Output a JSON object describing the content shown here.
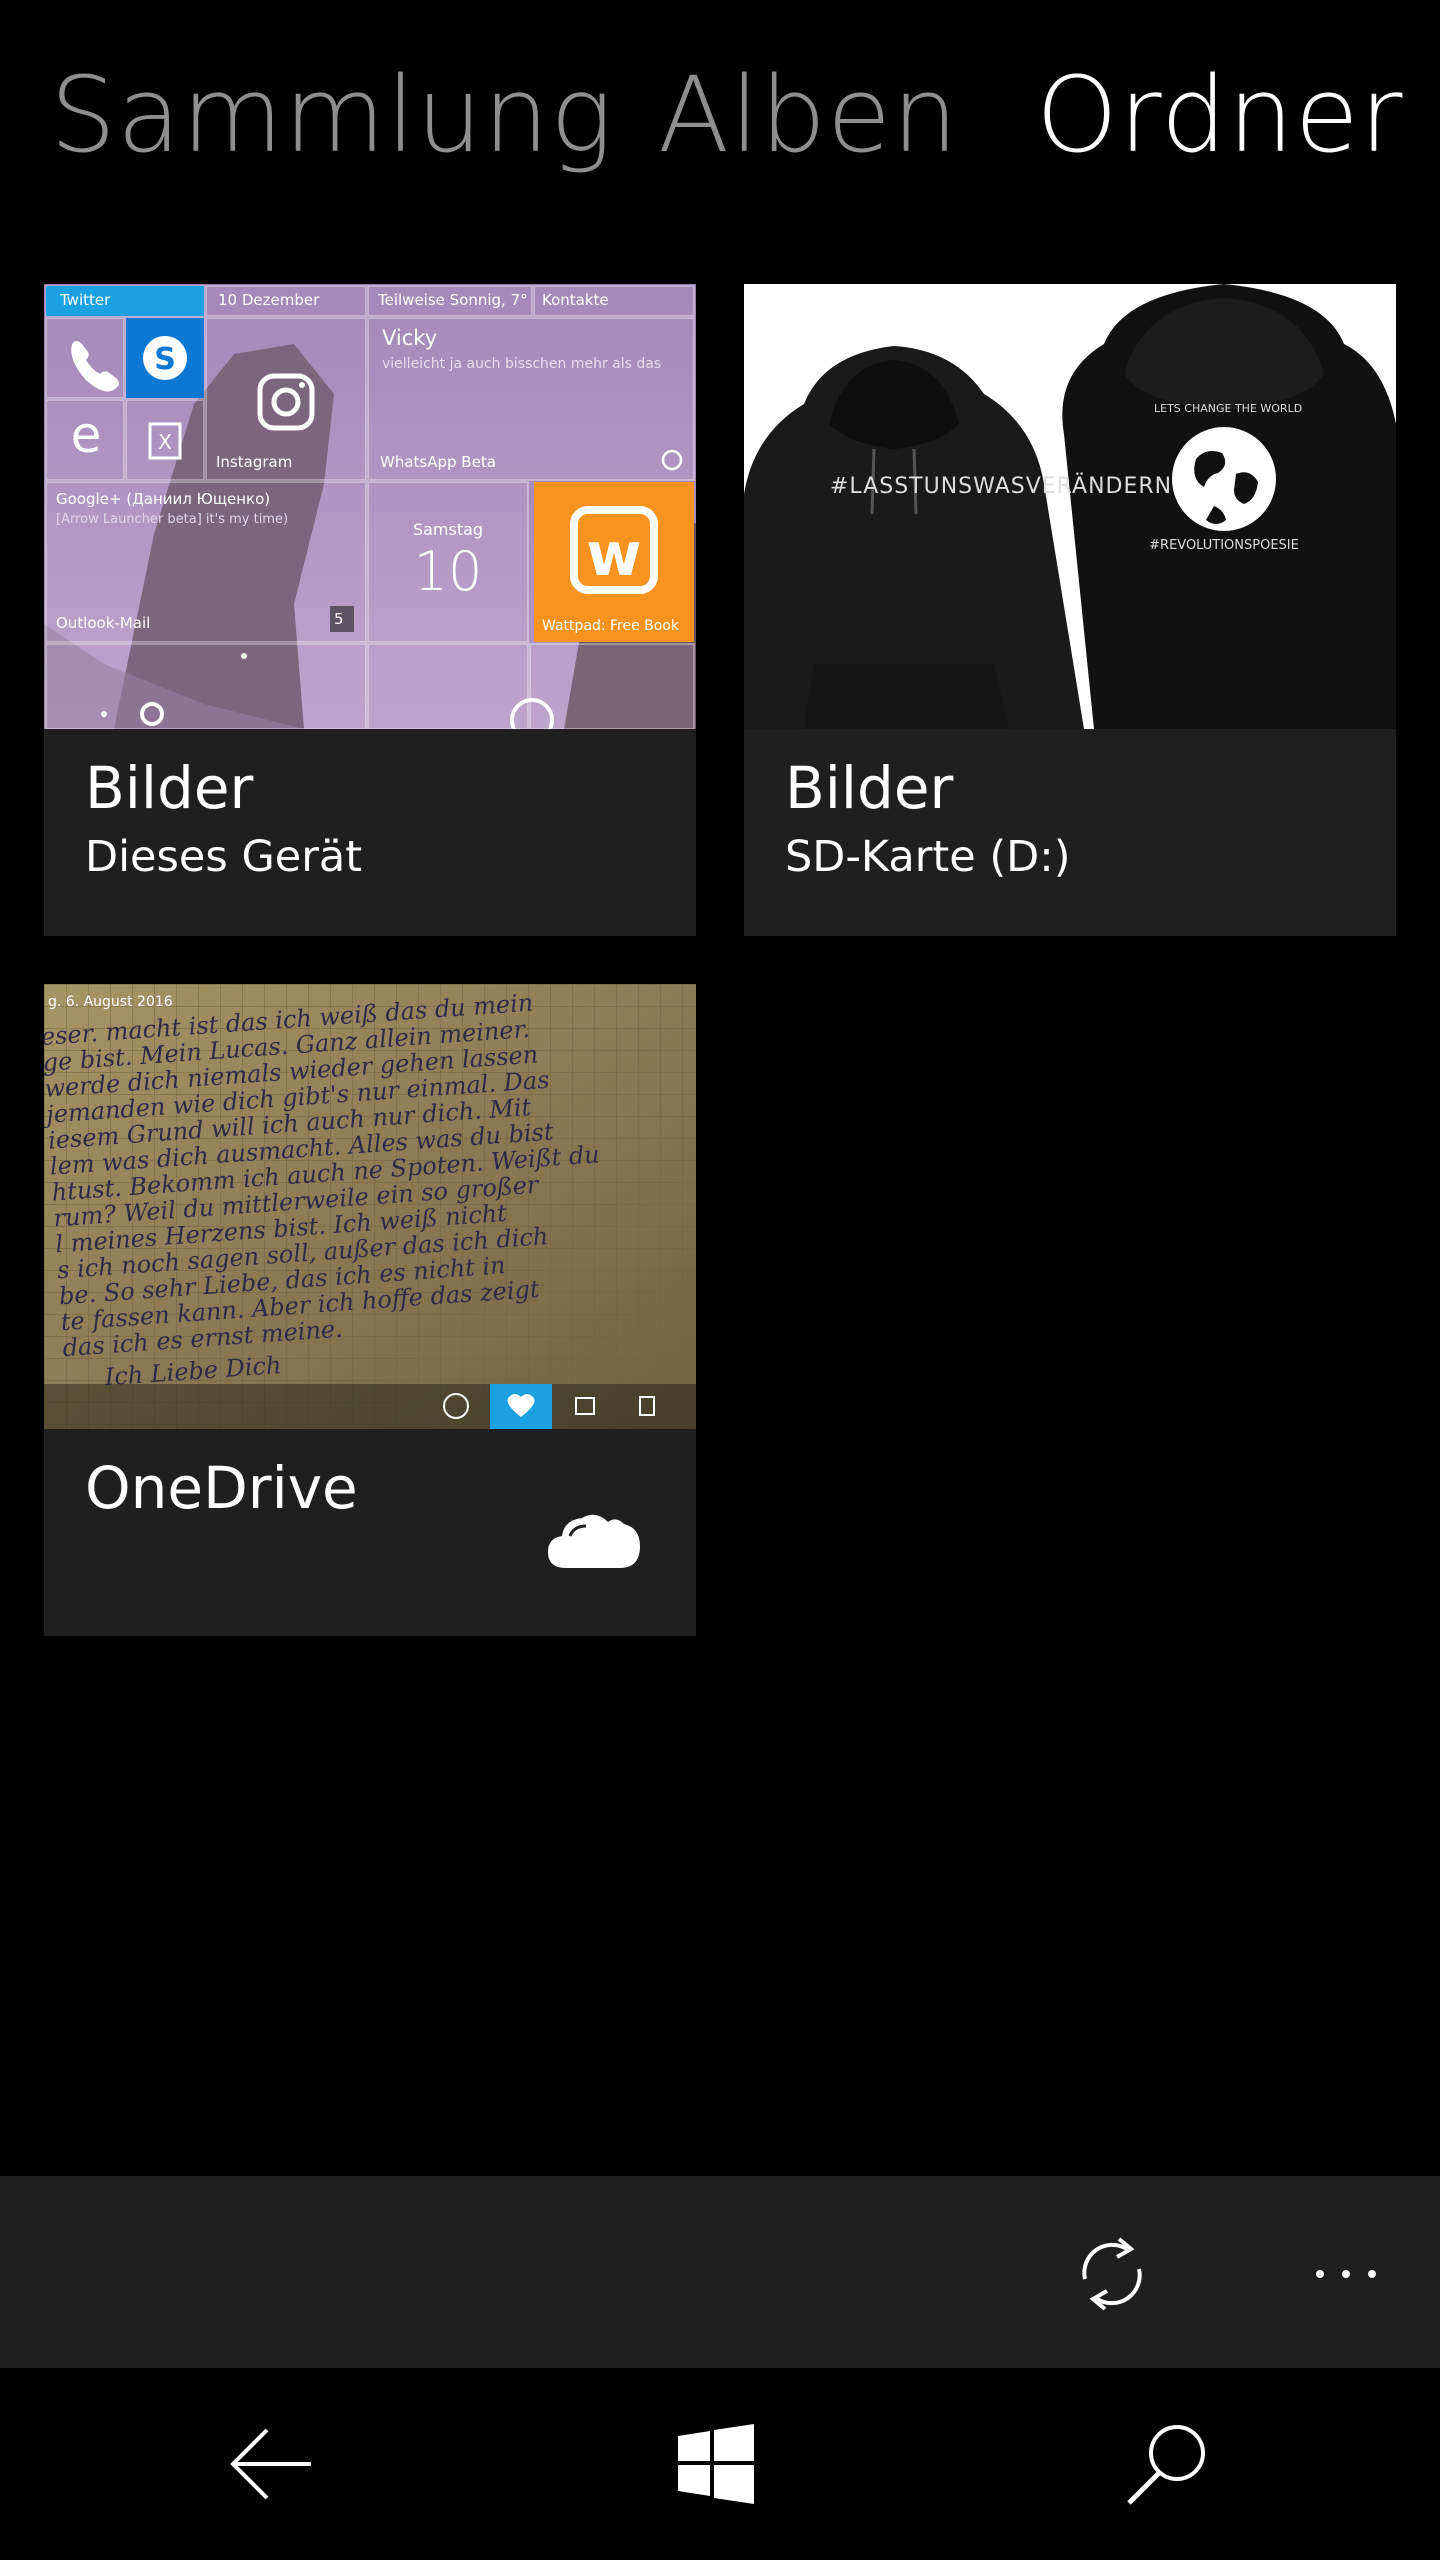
{
  "pivot": {
    "tabs": [
      {
        "label": "Sammlung",
        "active": false
      },
      {
        "label": "Alben",
        "active": false
      },
      {
        "label": "Ordner",
        "active": true
      }
    ]
  },
  "folders": [
    {
      "title": "Bilder",
      "subtitle": "Dieses Gerät",
      "thumb": {
        "tiles": {
          "twitter": "Twitter",
          "date": "10 Dezember",
          "weather": "Teilweise Sonnig, 7°",
          "contacts": "Kontakte",
          "contact_name": "Vicky",
          "contact_msg": "vielleicht ja auch bisschen mehr als das",
          "instagram": "Instagram",
          "whatsapp": "WhatsApp Beta",
          "google_plus": "Google+ (Даниил Ющенко)",
          "google_plus_msg": "[Arrow Launcher beta] it's my time)",
          "day_name": "Samstag",
          "day_number": "10",
          "wattpad": "Wattpad: Free Book",
          "outlook": "Outlook-Mail",
          "outlook_count": "5"
        }
      }
    },
    {
      "title": "Bilder",
      "subtitle": "SD-Karte (D:)",
      "thumb": {
        "hoodie_front_text": "#LASSTUNSWASVERÄNDERN",
        "hoodie_back_text_top": "LETS CHANGE THE WORLD",
        "hoodie_back_text_bottom": "#REVOLUTIONSPOESIE"
      }
    },
    {
      "title": "OneDrive",
      "subtitle": "",
      "icon": "cloud-icon",
      "thumb": {
        "date_label": "g. 6. August 2016",
        "handwriting_lines": [
          "eser. macht ist das ich weiß das du mein",
          "ge bist. Mein Lucas. Ganz allein meiner.",
          "werde dich niemals wieder gehen lassen",
          "jemanden wie dich gibt's nur einmal. Das",
          "iesem Grund will ich auch nur dich. Mit",
          "lem was dich ausmacht. Alles was du bist",
          "htust. Bekomm ich auch ne Spoten. Weißt du",
          "rum? Weil du mittlerweile ein so großer",
          "l meines Herzens bist. Ich weiß nicht",
          "s ich noch sagen soll, außer das ich dich",
          "be. So sehr Liebe, das ich es nicht in",
          "te fassen kann. Aber ich hoffe das zeigt",
          "das ich es ernst meine.",
          "Ich Liebe Dich"
        ]
      }
    }
  ],
  "app_bar": {
    "sync_icon": "sync-icon",
    "more_icon": "more-icon"
  },
  "nav_bar": {
    "back_icon": "back-arrow-icon",
    "start_icon": "windows-logo-icon",
    "search_icon": "search-icon"
  },
  "colors": {
    "background": "#000000",
    "tile_bg": "#1f1f1f",
    "inactive_tab": "#8f8f8f",
    "accent_blue": "#1ba1e2",
    "wattpad_orange": "#f7931e"
  }
}
